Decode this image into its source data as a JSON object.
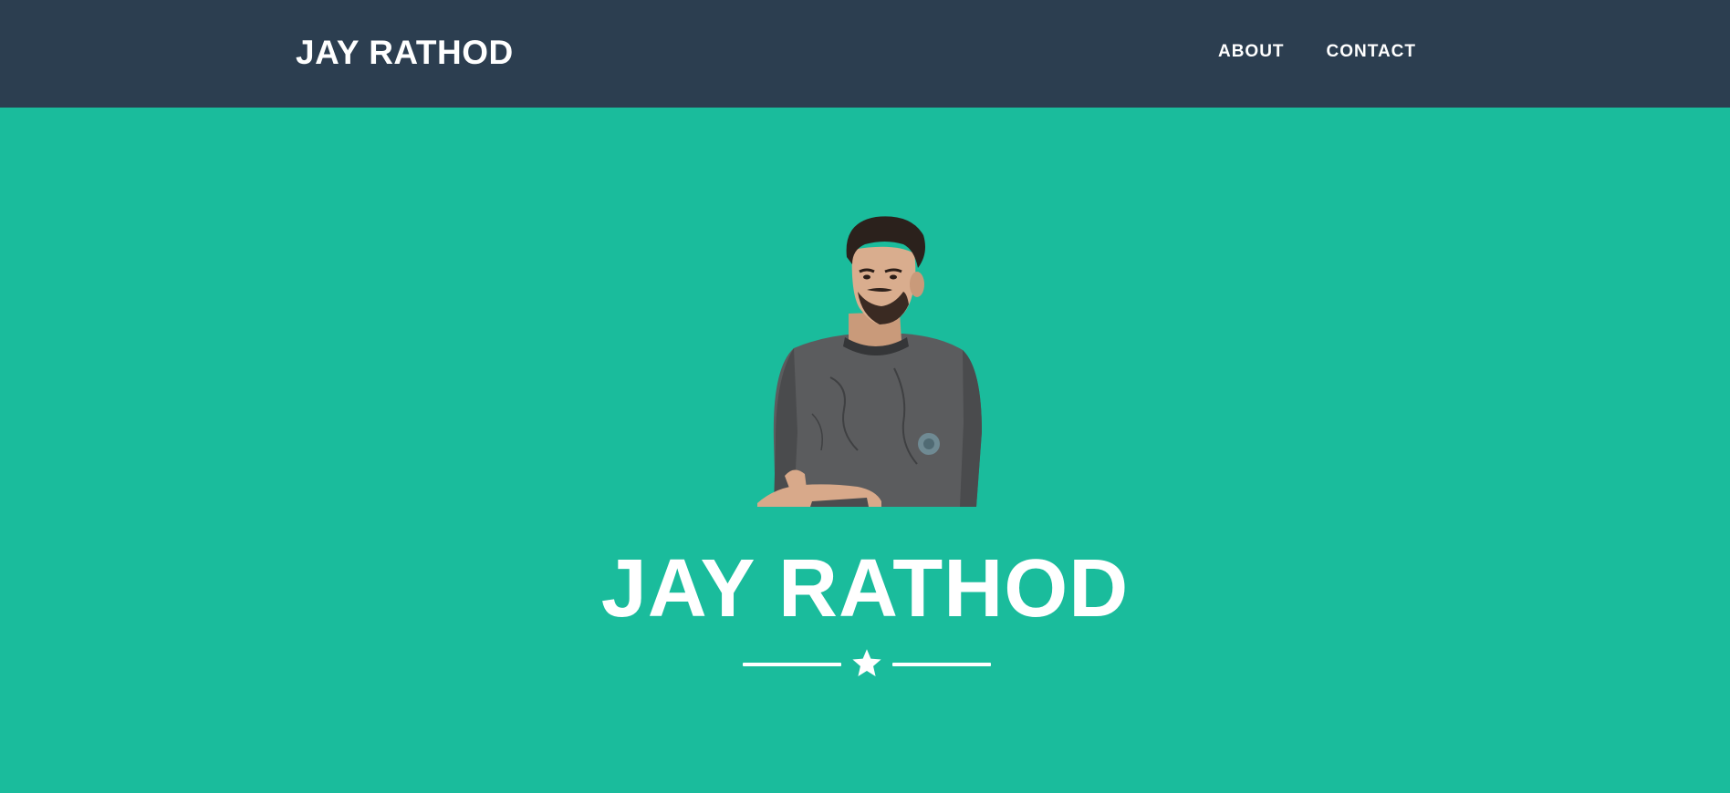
{
  "navbar": {
    "brand": "JAY RATHOD",
    "links": [
      {
        "label": "ABOUT"
      },
      {
        "label": "CONTACT"
      }
    ]
  },
  "masthead": {
    "avatar": "portrait-photo",
    "heading": "JAY RATHOD",
    "divider_icon": "star-icon"
  },
  "colors": {
    "navbar_bg": "#2c3e50",
    "masthead_bg": "#1abc9c",
    "text": "#ffffff"
  }
}
